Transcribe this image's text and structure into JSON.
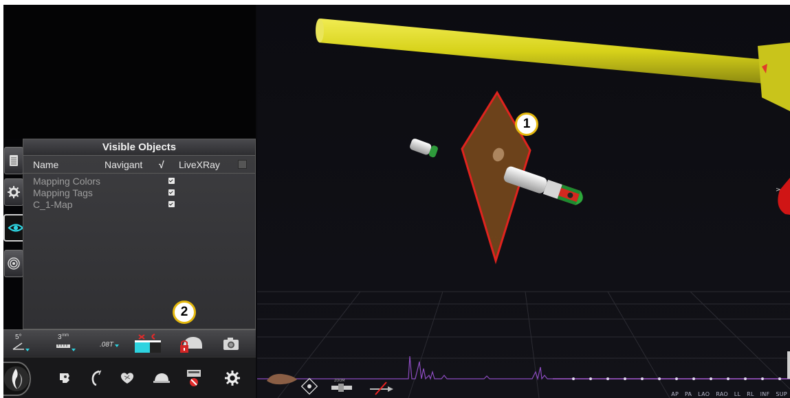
{
  "visible_objects_panel": {
    "title": "Visible Objects",
    "columns": {
      "name": "Name",
      "navigant": "Navigant",
      "navigant_check": "√",
      "livexray": "LiveXRay"
    },
    "rows": [
      {
        "label": "Mapping Colors",
        "navigant_checked": true
      },
      {
        "label": "Mapping Tags",
        "navigant_checked": true
      },
      {
        "label": "C_1-Map",
        "navigant_checked": true
      }
    ]
  },
  "side_tabs": [
    "document-icon",
    "gear-icon",
    "eye-icon",
    "target-icon"
  ],
  "toolbar": {
    "angle_label": "5°",
    "distance_value": "3",
    "distance_unit": "mm",
    "field_value": ".08T",
    "icons": [
      "angle-icon",
      "distance-icon",
      "field-strength-icon",
      "magnet-toggle-icon",
      "lock-helmet-icon",
      "camera-icon"
    ]
  },
  "bottom_bar": {
    "icons": [
      "navigant-logo-icon",
      "catheter-icon",
      "curve-icon",
      "heart-icon",
      "helmet-icon",
      "no-record-icon",
      "settings-gear-icon"
    ]
  },
  "viewport": {
    "zoom_label": "ZOOM",
    "view_buttons": [
      "AP",
      "PA",
      "LAO",
      "RAO",
      "LL",
      "RL",
      "INF",
      "SUP"
    ]
  },
  "callouts": {
    "one": "1",
    "two": "2"
  },
  "colors": {
    "accent_cyan": "#2ed3e0",
    "arrow_yellow": "#d7d21a",
    "plane_brown": "#7a4a1c",
    "plane_outline": "#e0231e",
    "trace_purple": "#a75bd6",
    "callout_border": "#e4b80e"
  }
}
